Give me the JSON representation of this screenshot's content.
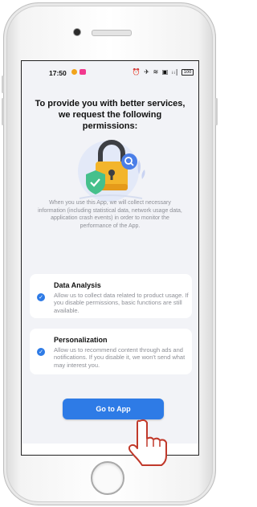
{
  "status_bar": {
    "time": "17:50",
    "right_icons": "⏰ ✈ ≋ ▣ ᵢᵢ|",
    "battery": "100"
  },
  "header": {
    "title": "To provide you with better services, we request the following permissions:"
  },
  "illustration": {
    "icons": [
      "padlock-icon",
      "shield-check-icon",
      "magnifier-icon"
    ]
  },
  "intro_text": "When you use this App, we will collect necessary information (including statistical data, network usage data, application crash events) in order to monitor the performance of the App.",
  "permissions": [
    {
      "title": "Data Analysis",
      "description": "Allow us to collect data related to product usage. If you disable permissions, basic functions are still available.",
      "checked": true
    },
    {
      "title": "Personalization",
      "description": "Allow us to recommend content through ads and notifications. If you disable it, we won't send what may interest you.",
      "checked": true
    }
  ],
  "cta": {
    "label": "Go to App"
  },
  "colors": {
    "accent": "#2e7be6",
    "screen_bg": "#f2f3f7",
    "hand_outline": "#c0392b"
  }
}
